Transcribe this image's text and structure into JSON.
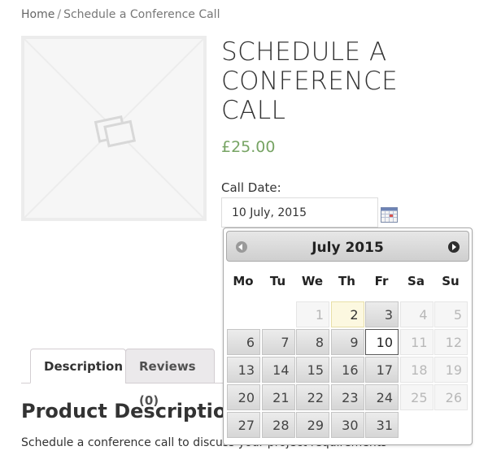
{
  "breadcrumb": {
    "home": "Home",
    "separator": "/",
    "current": "Schedule a Conference Call"
  },
  "product": {
    "title": "SCHEDULE A CONFERENCE CALL",
    "price": "£25.00",
    "price_color": "#77a464",
    "image_icon": "image-placeholder-icon"
  },
  "booking": {
    "label": "Call Date:",
    "value": "10 July, 2015",
    "trigger_icon": "calendar-icon"
  },
  "datepicker": {
    "month_label": "July 2015",
    "prev_icon": "prev-month-icon",
    "next_icon": "next-month-icon",
    "weekdays": [
      "Mo",
      "Tu",
      "We",
      "Th",
      "Fr",
      "Sa",
      "Su"
    ],
    "weeks": [
      [
        null,
        null,
        "1",
        "2",
        "3",
        "4",
        "5"
      ],
      [
        "6",
        "7",
        "8",
        "9",
        "10",
        "11",
        "12"
      ],
      [
        "13",
        "14",
        "15",
        "16",
        "17",
        "18",
        "19"
      ],
      [
        "20",
        "21",
        "22",
        "23",
        "24",
        "25",
        "26"
      ],
      [
        "27",
        "28",
        "29",
        "30",
        "31",
        null,
        null
      ]
    ],
    "disabled_days": [
      "1",
      "4",
      "5",
      "11",
      "12",
      "18",
      "19",
      "25",
      "26"
    ],
    "today": "2",
    "selected": "10"
  },
  "tabs": [
    {
      "label": "Description",
      "active": true
    },
    {
      "label": "Reviews (0)",
      "active": false
    }
  ],
  "description": {
    "heading": "Product Description",
    "text": "Schedule a conference call to discuss your project requirements"
  }
}
